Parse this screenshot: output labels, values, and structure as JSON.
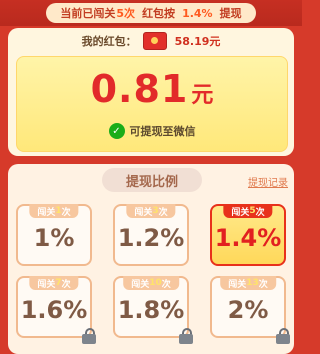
{
  "header": {
    "prefix": "当前已闯关",
    "level": "5次",
    "middle": "红包按",
    "rate": "1.4%",
    "suffix": "提现"
  },
  "wallet": {
    "label": "我的红包：",
    "amount": "58.19元",
    "withdraw_amount": "0.81",
    "withdraw_unit": "元",
    "wechat_text": "可提现至微信"
  },
  "ratios": {
    "title": "提现比例",
    "record_link": "提现记录",
    "tiles": [
      {
        "prefix": "闯关",
        "level": "1",
        "suffix": "次",
        "pct": "1%",
        "active": false,
        "locked": false
      },
      {
        "prefix": "闯关",
        "level": "3",
        "suffix": "次",
        "pct": "1.2%",
        "active": false,
        "locked": false
      },
      {
        "prefix": "闯关",
        "level": "5",
        "suffix": "次",
        "pct": "1.4%",
        "active": true,
        "locked": false
      },
      {
        "prefix": "闯关",
        "level": "7",
        "suffix": "次",
        "pct": "1.6%",
        "active": false,
        "locked": true
      },
      {
        "prefix": "闯关",
        "level": "10",
        "suffix": "次",
        "pct": "1.8%",
        "active": false,
        "locked": true
      },
      {
        "prefix": "闯关",
        "level": "13",
        "suffix": "次",
        "pct": "2%",
        "active": false,
        "locked": true
      }
    ]
  }
}
